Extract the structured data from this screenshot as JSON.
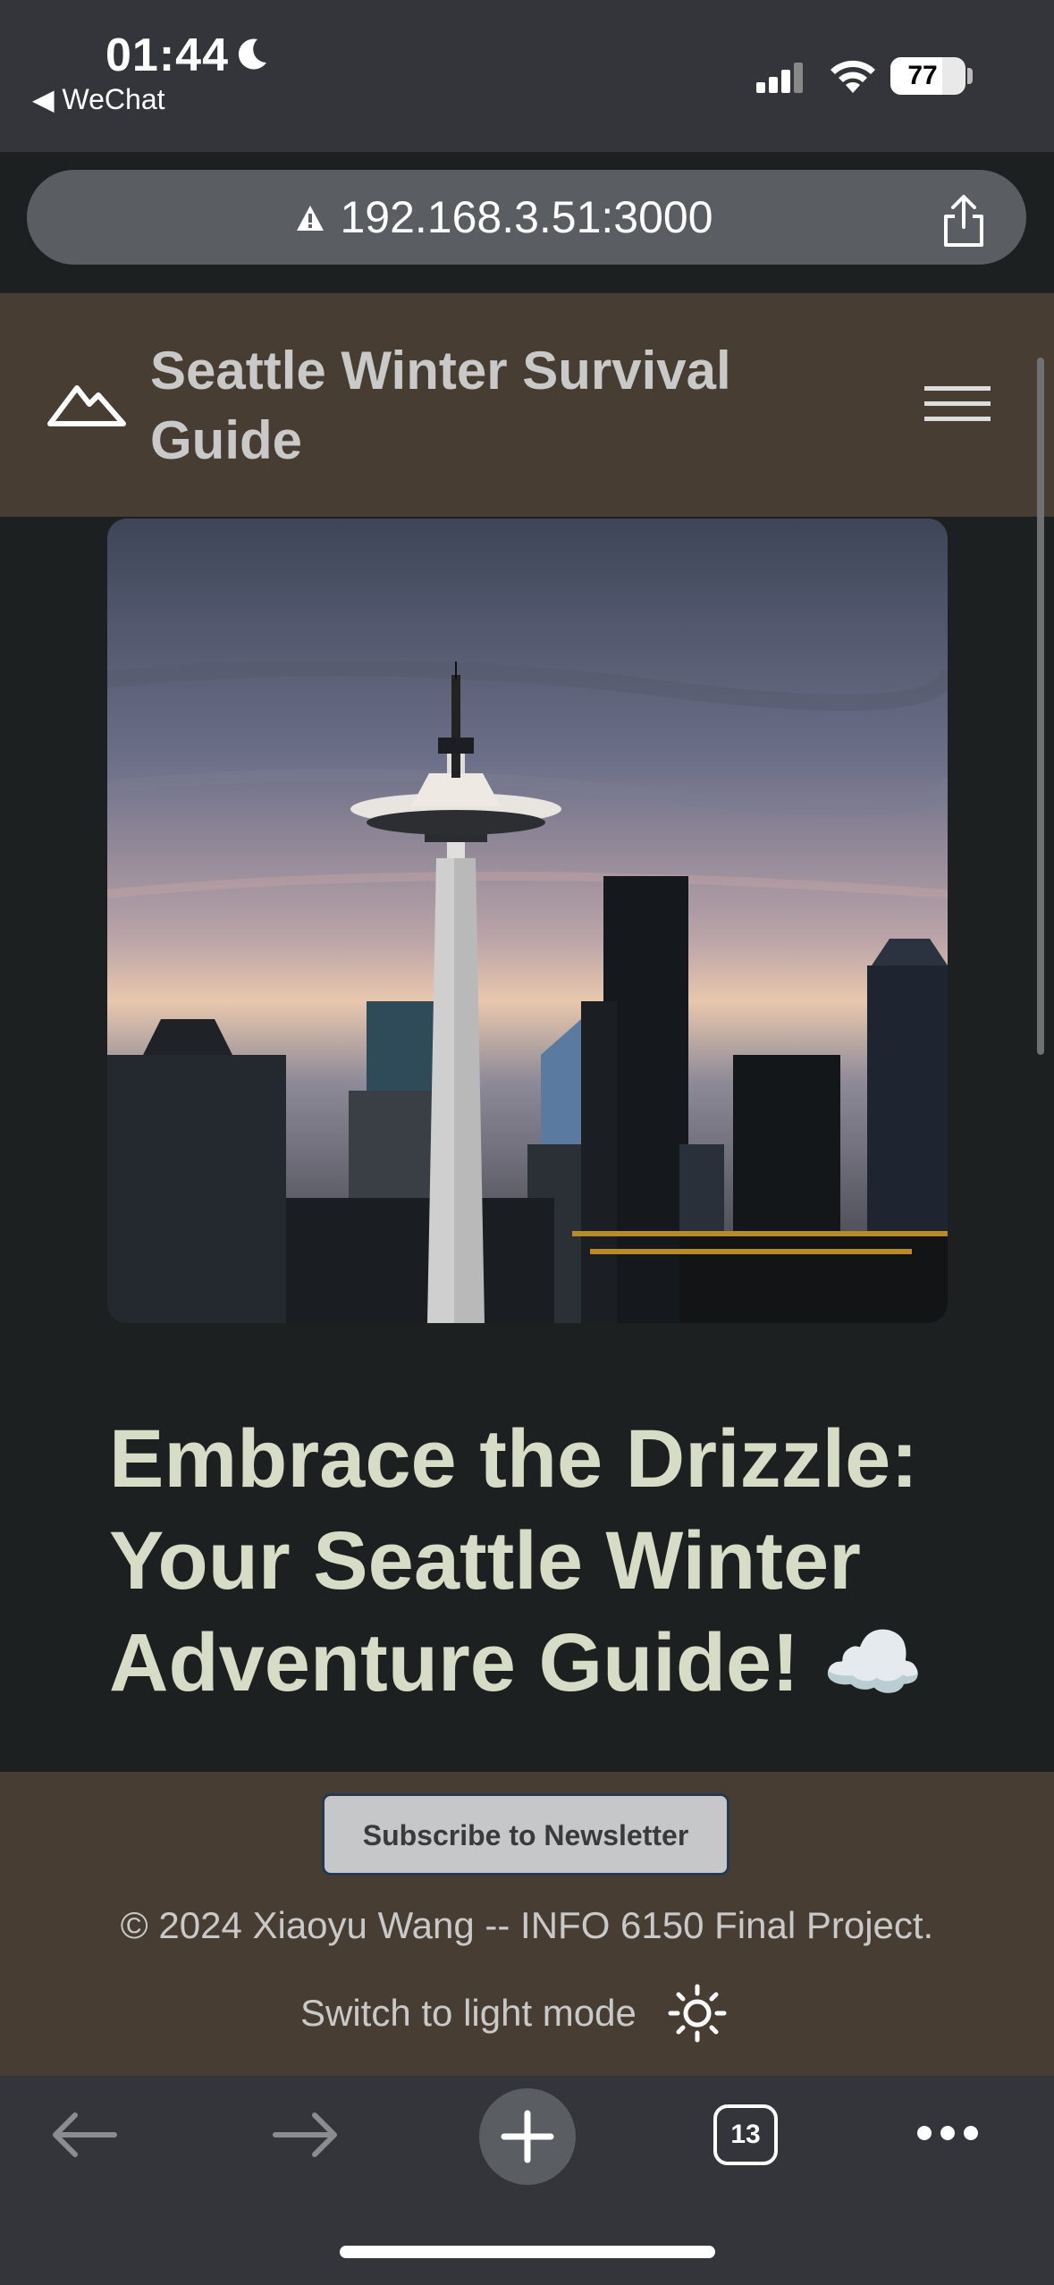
{
  "status_bar": {
    "time": "01:44",
    "back_app": "◀ WeChat",
    "battery": "77"
  },
  "browser": {
    "url": "192.168.3.51:3000",
    "tab_count": "13"
  },
  "site": {
    "title": "Seattle Winter Survival Guide",
    "hero_alt": "Seattle skyline with Space Needle at dusk",
    "headline": "Embrace the Drizzle: Your Seattle Winter Adventure Guide! ☁️",
    "subscribe_label": "Subscribe to Newsletter",
    "copyright": "© 2024 Xiaoyu Wang -- INFO 6150 Final Project.",
    "light_mode_label": "Switch to light mode"
  },
  "colors": {
    "header_bg": "#483d33",
    "page_bg": "#1d2021",
    "headline": "#d6dcc5"
  },
  "icons": [
    "moon-icon",
    "signal-icon",
    "wifi-icon",
    "warning-icon",
    "share-icon",
    "mountain-logo-icon",
    "hamburger-menu-icon",
    "sun-icon",
    "back-arrow-icon",
    "forward-arrow-icon",
    "plus-icon",
    "tabs-icon",
    "more-icon"
  ]
}
